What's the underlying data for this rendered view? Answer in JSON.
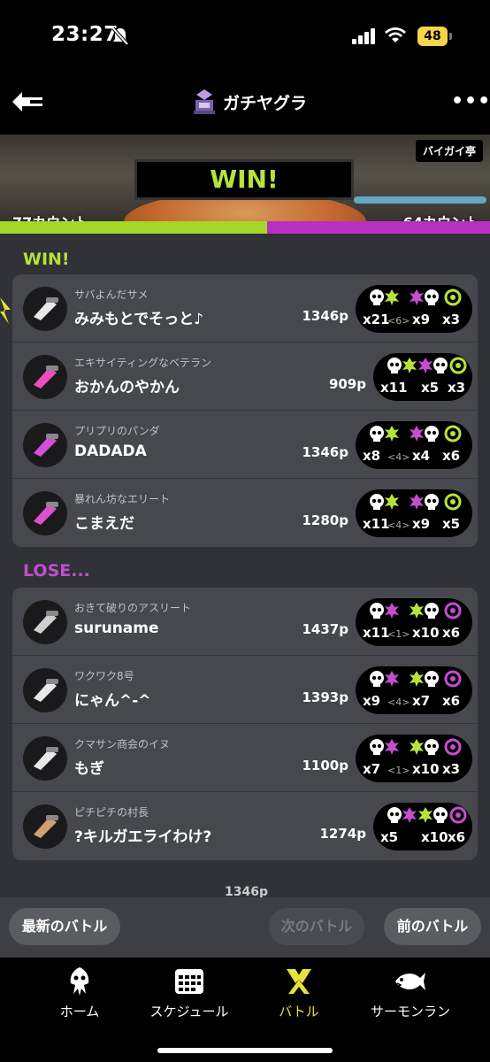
{
  "status_bar": {
    "time": "23:27",
    "battery": "48"
  },
  "nav": {
    "mode": "ガチヤグラ",
    "more": "•••"
  },
  "banner": {
    "stage": "バイガイ亭",
    "result": "WIN!",
    "my_count": "77カウント",
    "enemy_count": "64カウント",
    "my_share": 0.546
  },
  "win_section": {
    "label": "WIN!",
    "players": [
      {
        "title": "サバよんだサメ",
        "name": "みみもとでそっと♪",
        "points": "1346p",
        "kills": "x21",
        "assists": "<6>",
        "deaths": "x9",
        "specials": "x3"
      },
      {
        "title": "エキサイティングなベテラン",
        "name": "おかんのやかん",
        "points": "909p",
        "kills": "x11",
        "assists": "",
        "deaths": "x5",
        "specials": "x3"
      },
      {
        "title": "プリプリのパンダ",
        "name": "DADADA",
        "points": "1346p",
        "kills": "x8",
        "assists": "<4>",
        "deaths": "x4",
        "specials": "x6"
      },
      {
        "title": "暴れん坊なエリート",
        "name": "こまえだ",
        "points": "1280p",
        "kills": "x11",
        "assists": "<4>",
        "deaths": "x9",
        "specials": "x5"
      }
    ]
  },
  "lose_section": {
    "label": "LOSE...",
    "players": [
      {
        "title": "おきて破りのアスリート",
        "name": "suruname",
        "points": "1437p",
        "kills": "x11",
        "assists": "<1>",
        "deaths": "x10",
        "specials": "x6"
      },
      {
        "title": "ワクワク8号",
        "name": "にゃん^-^",
        "points": "1393p",
        "kills": "x9",
        "assists": "<4>",
        "deaths": "x7",
        "specials": "x6"
      },
      {
        "title": "クマサン商会のイヌ",
        "name": "もぎ",
        "points": "1100p",
        "kills": "x7",
        "assists": "<1>",
        "deaths": "x10",
        "specials": "x3"
      },
      {
        "title": "ピチピチの村長",
        "name": "?キルガエライわけ?",
        "points": "1274p",
        "kills": "x5",
        "assists": "",
        "deaths": "x10",
        "specials": "x6"
      }
    ]
  },
  "peek_text": "1346p",
  "battle_nav": {
    "latest": "最新のバトル",
    "next": "次のバトル",
    "prev": "前のバトル"
  },
  "tabs": [
    {
      "label": "ホーム",
      "icon": "squid-icon"
    },
    {
      "label": "スケジュール",
      "icon": "calendar-icon"
    },
    {
      "label": "バトル",
      "icon": "battle-icon"
    },
    {
      "label": "サーモンラン",
      "icon": "salmon-icon"
    }
  ],
  "colors": {
    "win": "#b7e23a",
    "lose": "#c44dd0",
    "active_tab": "#e5e23a"
  }
}
